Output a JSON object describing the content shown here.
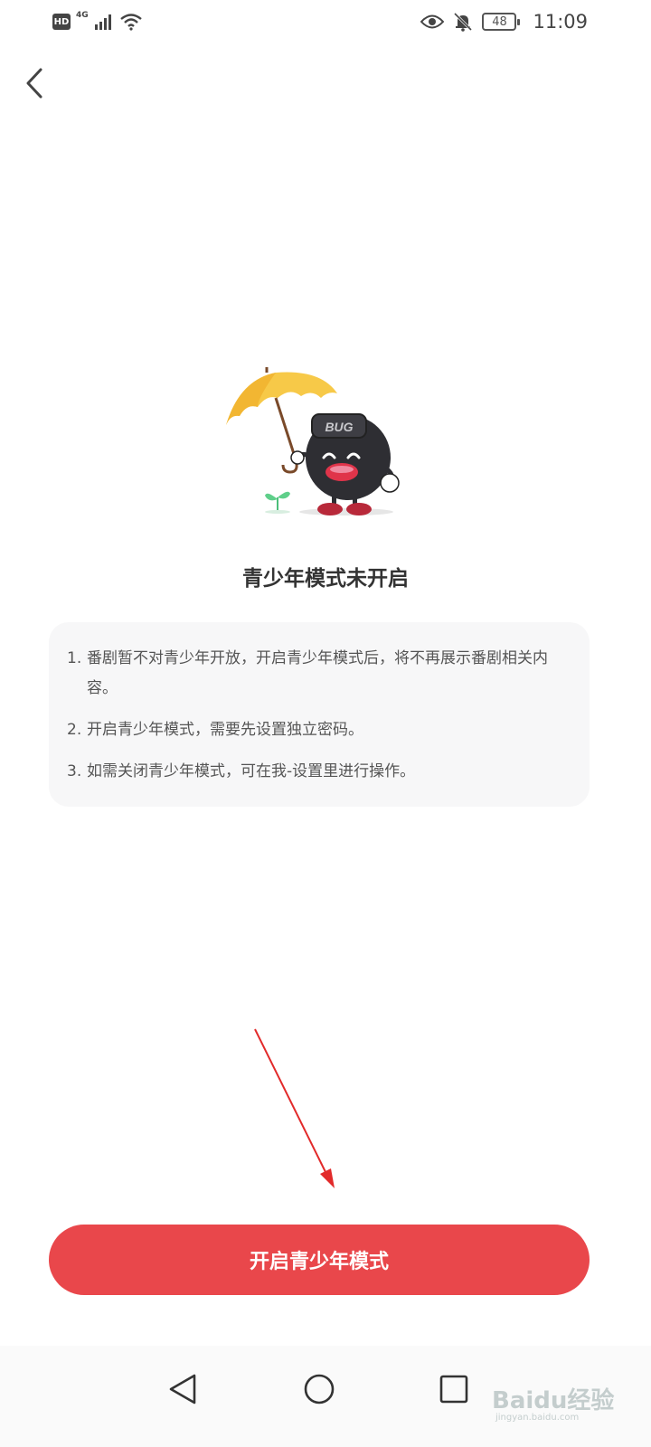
{
  "status_bar": {
    "hd_badge": "HD",
    "network_label": "4G",
    "battery_level": "48",
    "time": "11:09",
    "icons": [
      "hd-icon",
      "signal-icon",
      "wifi-icon",
      "eye-icon",
      "bell-muted-icon",
      "battery-icon"
    ]
  },
  "header": {
    "back_icon": "chevron-left-icon"
  },
  "main": {
    "title": "青少年模式未开启",
    "mascot_badge": "BUG",
    "items": [
      {
        "num": "1.",
        "text": "番剧暂不对青少年开放，开启青少年模式后，将不再展示番剧相关内容。"
      },
      {
        "num": "2.",
        "text": "开启青少年模式，需要先设置独立密码。"
      },
      {
        "num": "3.",
        "text": "如需关闭青少年模式，可在我-设置里进行操作。"
      }
    ]
  },
  "action": {
    "button_label": "开启青少年模式"
  },
  "nav": {
    "icons": [
      "back-triangle-icon",
      "home-circle-icon",
      "recents-square-icon"
    ]
  },
  "watermark": {
    "main": "Baidu经验",
    "sub": "jingyan.baidu.com"
  },
  "colors": {
    "primary": "#e9474b",
    "card_bg": "#f7f7f8",
    "umbrella": "#f7c948",
    "annotation": "#e22a2a"
  }
}
